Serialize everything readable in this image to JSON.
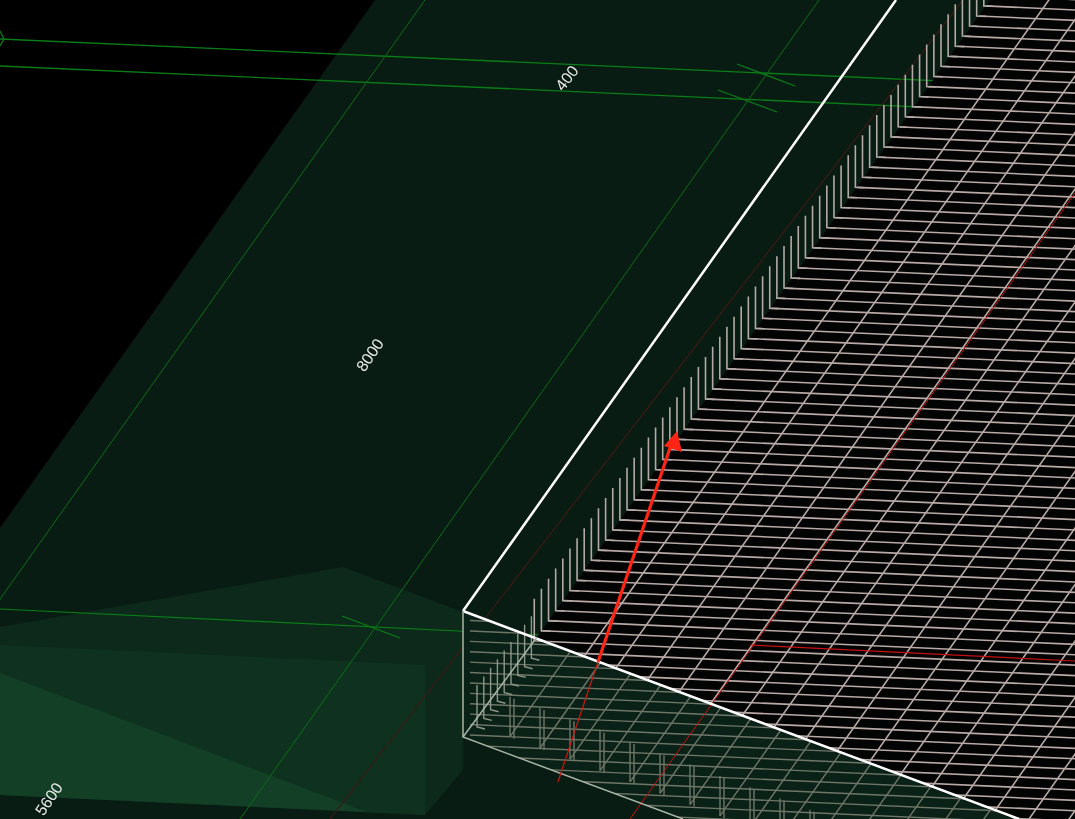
{
  "viewport": {
    "dimension_labels": [
      {
        "text": "400"
      },
      {
        "text": "8000"
      },
      {
        "text": "5600"
      }
    ]
  }
}
